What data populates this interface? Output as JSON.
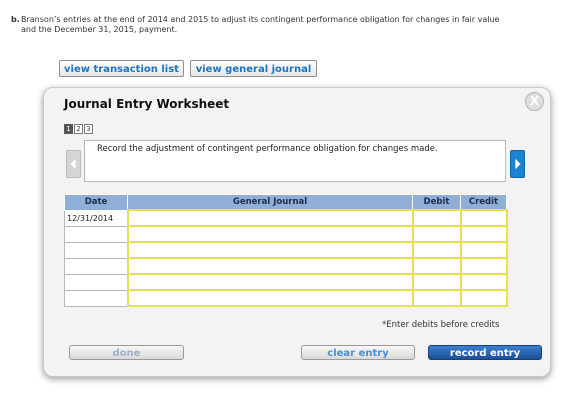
{
  "question": {
    "number": "b.",
    "text": "Branson’s entries at the end of 2014 and 2015 to adjust its contingent performance obligation for changes in fair value and the December 31, 2015, payment."
  },
  "top_buttons": {
    "view_transaction_list": "view transaction list",
    "view_general_journal": "view general journal"
  },
  "worksheet": {
    "title": "Journal Entry Worksheet",
    "close_symbol": "X",
    "steps": [
      "1",
      "2",
      "3"
    ],
    "active_step": "1",
    "instruction": "Record the adjustment of contingent performance obligation for changes made.",
    "columns": {
      "date": "Date",
      "general_journal": "General Journal",
      "debit": "Debit",
      "credit": "Credit"
    },
    "rows": [
      {
        "date": "12/31/2014",
        "account": "",
        "debit": "",
        "credit": ""
      },
      {
        "date": "",
        "account": "",
        "debit": "",
        "credit": ""
      },
      {
        "date": "",
        "account": "",
        "debit": "",
        "credit": ""
      },
      {
        "date": "",
        "account": "",
        "debit": "",
        "credit": ""
      },
      {
        "date": "",
        "account": "",
        "debit": "",
        "credit": ""
      },
      {
        "date": "",
        "account": "",
        "debit": "",
        "credit": ""
      }
    ],
    "note": "*Enter debits before credits",
    "buttons": {
      "done": "done",
      "clear_entry": "clear entry",
      "record_entry": "record entry"
    }
  },
  "colors": {
    "header_blue": "#8fafd9",
    "input_yellow": "#e8e24a",
    "link_blue": "#1e73be",
    "record_button": "#1b4f96",
    "nav_right": "#1a84d3"
  }
}
